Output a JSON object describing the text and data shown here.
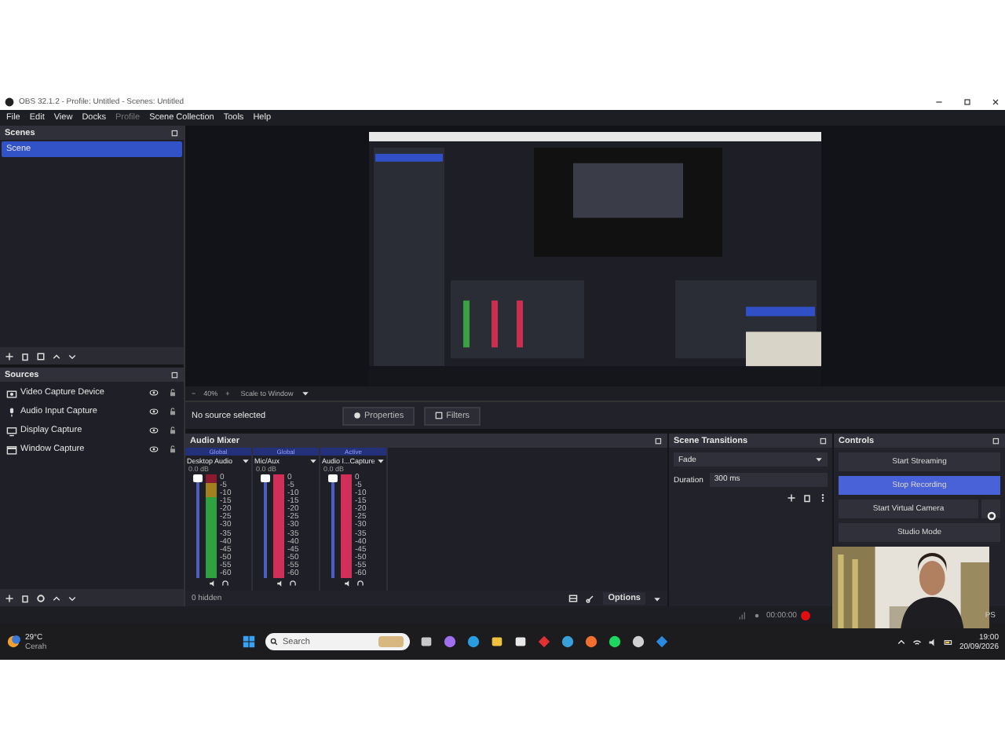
{
  "window": {
    "title": "OBS 32.1.2 - Profile: Untitled - Scenes: Untitled"
  },
  "menu": [
    {
      "label": "File",
      "disabled": false
    },
    {
      "label": "Edit",
      "disabled": false
    },
    {
      "label": "View",
      "disabled": false
    },
    {
      "label": "Docks",
      "disabled": false
    },
    {
      "label": "Profile",
      "disabled": true
    },
    {
      "label": "Scene Collection",
      "disabled": false
    },
    {
      "label": "Tools",
      "disabled": false
    },
    {
      "label": "Help",
      "disabled": false
    }
  ],
  "scenes": {
    "title": "Scenes",
    "items": [
      {
        "label": "Scene",
        "selected": true
      }
    ]
  },
  "preview_controls": {
    "zoom_out": "−",
    "zoom": "40%",
    "zoom_in": "+",
    "scale": "Scale to Window"
  },
  "sources": {
    "title": "Sources",
    "items": [
      {
        "label": "Video Capture Device",
        "kind": "camera"
      },
      {
        "label": "Audio Input Capture",
        "kind": "mic"
      },
      {
        "label": "Display Capture",
        "kind": "monitor"
      },
      {
        "label": "Window Capture",
        "kind": "window"
      }
    ]
  },
  "source_toolbar": {
    "status": "No source selected",
    "properties": "Properties",
    "filters": "Filters"
  },
  "audio_mixer": {
    "title": "Audio Mixer",
    "channels": [
      {
        "status": "Global",
        "name": "Desktop Audio",
        "reading": "0.0 dB",
        "level": 1,
        "muted": false,
        "scale": [
          "0",
          "-5",
          "-10",
          "-15",
          "-20",
          "-25",
          "-30",
          "-35",
          "-40",
          "-45",
          "-50",
          "-55",
          "-60"
        ]
      },
      {
        "status": "Global",
        "name": "Mic/Aux",
        "reading": "0.0 dB",
        "level": 1,
        "muted": true,
        "scale": [
          "0",
          "-5",
          "-10",
          "-15",
          "-20",
          "-25",
          "-30",
          "-35",
          "-40",
          "-45",
          "-50",
          "-55",
          "-60"
        ]
      },
      {
        "status": "Active",
        "name": "Audio I...Capture",
        "reading": "0.0 dB",
        "level": 1,
        "muted": true,
        "scale": [
          "0",
          "-5",
          "-10",
          "-15",
          "-20",
          "-25",
          "-30",
          "-35",
          "-40",
          "-45",
          "-50",
          "-55",
          "-60"
        ]
      }
    ],
    "hidden": "0 hidden",
    "options": "Options"
  },
  "scene_transitions": {
    "title": "Scene Transitions",
    "transition": "Fade",
    "duration_label": "Duration",
    "duration": "300 ms"
  },
  "controls": {
    "title": "Controls",
    "buttons": [
      {
        "label": "Start Streaming",
        "active": false,
        "gear": false
      },
      {
        "label": "Stop Recording",
        "active": true,
        "gear": false
      },
      {
        "label": "Start Virtual Camera",
        "active": false,
        "gear": true
      },
      {
        "label": "Studio Mode",
        "active": false,
        "gear": false
      }
    ]
  },
  "status_bar": {
    "time": "00:00:00",
    "recording": true,
    "fps": "PS"
  },
  "taskbar": {
    "temperature": "29°C",
    "weather": "Cerah",
    "search_placeholder": "Search",
    "time": "19:00",
    "date": "20/09/2026"
  }
}
